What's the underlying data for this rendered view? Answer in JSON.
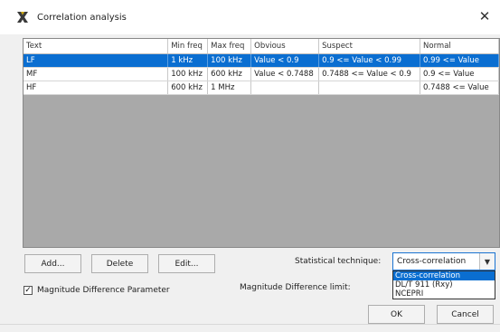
{
  "window": {
    "title": "Correlation analysis",
    "close_glyph": "✕"
  },
  "table": {
    "columns": [
      "Text",
      "Min freq",
      "Max freq",
      "Obvious",
      "Suspect",
      "Normal"
    ],
    "rows": [
      [
        "LF",
        "1 kHz",
        "100 kHz",
        "Value < 0.9",
        "0.9 <= Value < 0.99",
        "0.99 <= Value"
      ],
      [
        "MF",
        "100 kHz",
        "600 kHz",
        "Value < 0.7488",
        "0.7488 <= Value < 0.9",
        "0.9 <= Value"
      ],
      [
        "HF",
        "600 kHz",
        "1 MHz",
        "",
        "",
        "0.7488 <= Value"
      ]
    ],
    "selected_row": 0
  },
  "buttons": {
    "add": "Add...",
    "delete": "Delete",
    "edit": "Edit...",
    "ok": "OK",
    "cancel": "Cancel"
  },
  "statistical": {
    "label": "Statistical technique:",
    "selected": "Cross-correlation",
    "options": [
      "Cross-correlation",
      "DL/T 911 (Rxy)",
      "NCEPRI"
    ]
  },
  "magnitude": {
    "checkbox_label": "Magnitude Difference Parameter",
    "checked": true,
    "limit_label": "Magnitude Difference limit:"
  },
  "icons": {
    "app": "x-logo-icon",
    "close": "close-icon",
    "dropdown_arrow": "chevron-down-icon",
    "checkbox": "checkmark-icon"
  },
  "colors": {
    "selection": "#0a6ed1",
    "table_bg": "#a9a9a9",
    "dialog_bg": "#f0f0f0"
  }
}
